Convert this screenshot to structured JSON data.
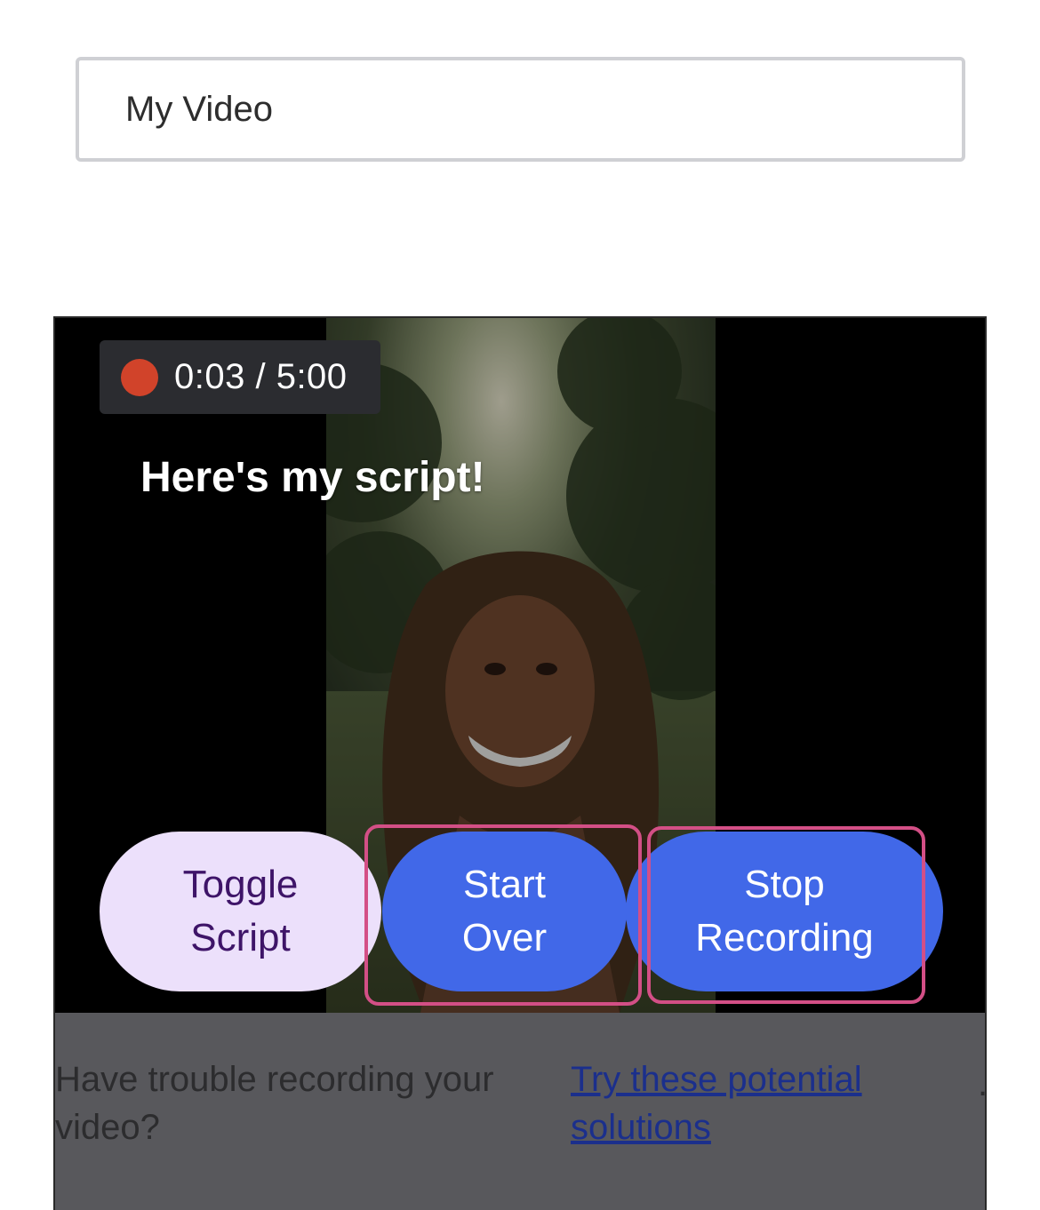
{
  "title_field": {
    "value": "My Video"
  },
  "recorder": {
    "timer": "0:03 / 5:00",
    "script_text": "Here's my script!",
    "buttons": {
      "toggle_script": "Toggle\nScript",
      "start_over": "Start\nOver",
      "stop_recording": "Stop\nRecording"
    }
  },
  "help": {
    "trouble_text": "Have trouble recording your video?",
    "link_text": "Try these potential solutions",
    "trailing": "."
  },
  "colors": {
    "accent": "#4168e8",
    "toggle_bg": "#ece0fb",
    "record_dot": "#d1432a",
    "highlight": "#d34f86"
  }
}
